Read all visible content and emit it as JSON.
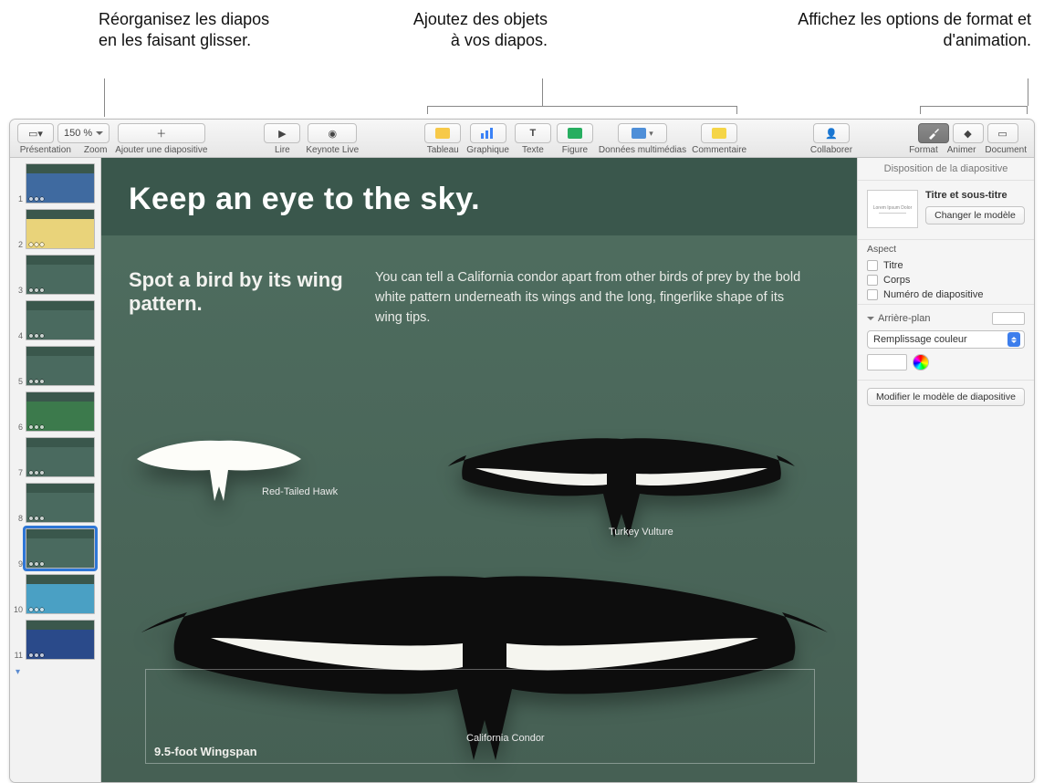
{
  "callouts": {
    "left": "Réorganisez les diapos en les faisant glisser.",
    "center": "Ajoutez des objets à vos diapos.",
    "right": "Affichez les options de format et d'animation."
  },
  "toolbar": {
    "presentation": "Présentation",
    "zoom_value": "150 %",
    "zoom": "Zoom",
    "add_slide": "Ajouter une diapositive",
    "play": "Lire",
    "keynote_live": "Keynote Live",
    "table": "Tableau",
    "chart": "Graphique",
    "text": "Texte",
    "shape": "Figure",
    "media": "Données multimédias",
    "comment": "Commentaire",
    "collaborate": "Collaborer",
    "format": "Format",
    "animate": "Animer",
    "document": "Document"
  },
  "slide": {
    "title": "Keep an eye to the sky.",
    "subheading": "Spot a bird by its wing pattern.",
    "paragraph": "You can tell a California condor apart from other birds of prey by the bold white pattern underneath its wings and the long, fingerlike shape of its wing tips.",
    "bird1": "Red-Tailed Hawk",
    "bird2": "Turkey Vulture",
    "bird3": "California Condor",
    "wingspan": "9.5-foot Wingspan"
  },
  "thumbs": {
    "selected": 9,
    "count": 11
  },
  "inspector": {
    "header": "Disposition de la diapositive",
    "layout_sample": "Lorem Ipsum Dolor",
    "layout_name": "Titre et sous-titre",
    "change_master": "Changer le modèle",
    "aspect": "Aspect",
    "chk_title": "Titre",
    "chk_body": "Corps",
    "chk_slidenum": "Numéro de diapositive",
    "background": "Arrière-plan",
    "fill_select": "Remplissage couleur",
    "edit_master": "Modifier le modèle de diapositive"
  }
}
